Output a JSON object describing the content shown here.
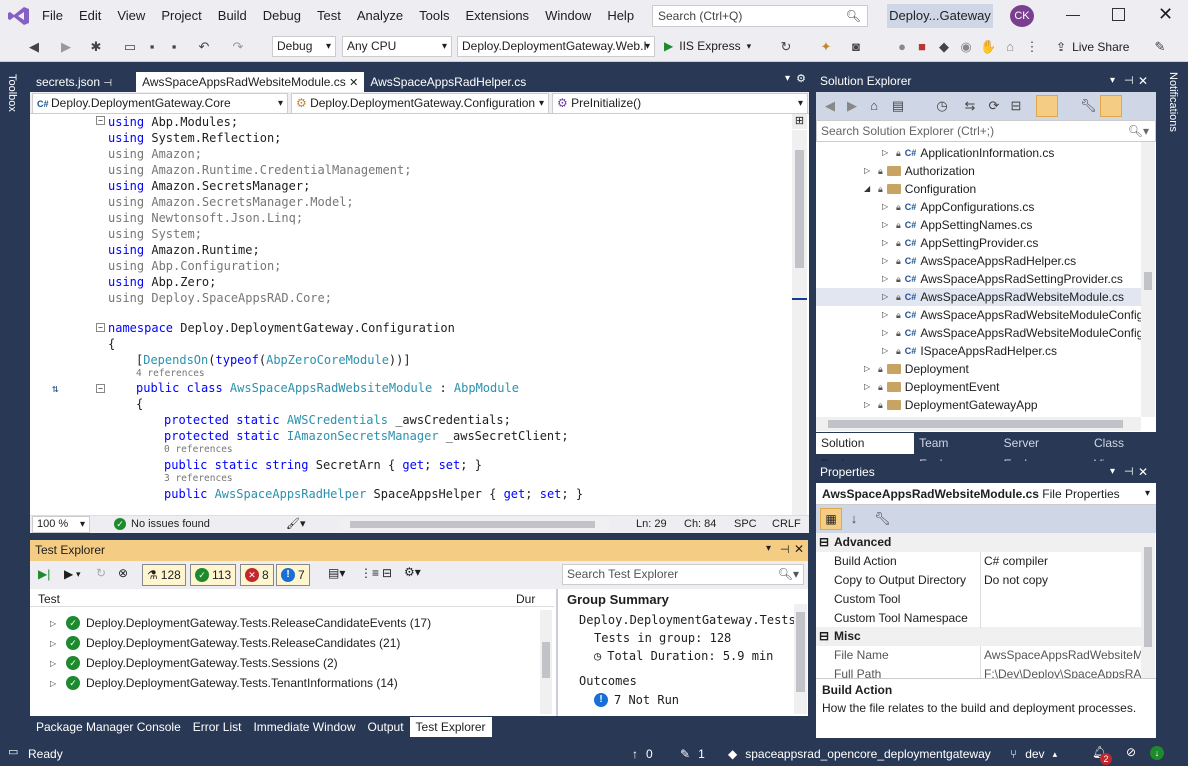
{
  "menu": [
    "File",
    "Edit",
    "View",
    "Project",
    "Build",
    "Debug",
    "Test",
    "Analyze",
    "Tools",
    "Extensions",
    "Window",
    "Help"
  ],
  "search_placeholder": "Search (Ctrl+Q)",
  "solution_short": "Deploy...Gateway",
  "user_initials": "CK",
  "toolbar": {
    "config": "Debug",
    "platform": "Any CPU",
    "startup": "Deploy.DeploymentGateway.Web.I",
    "run": "IIS Express",
    "live_share": "Live Share"
  },
  "side": {
    "toolbox": "Toolbox",
    "notifications": "Notifications"
  },
  "doc_tabs": [
    "secrets.json",
    "AwsSpaceAppsRadWebsiteModule.cs",
    "AwsSpaceAppsRadHelper.cs"
  ],
  "navbar": {
    "project": "Deploy.DeploymentGateway.Core",
    "type": "Deploy.DeploymentGateway.Configuration",
    "member": "PreInitialize()"
  },
  "code": {
    "u1": "using",
    "u1b": " Abp.Modules;",
    "u2b": " System.Reflection;",
    "u3b": " Amazon;",
    "u4b": " Amazon.Runtime.CredentialManagement;",
    "u5b": " Amazon.SecretsManager;",
    "u6b": " Amazon.SecretsManager.Model;",
    "u7b": " Newtonsoft.Json.Linq;",
    "u8b": " System;",
    "u9b": " Amazon.Runtime;",
    "u10b": " Abp.Configuration;",
    "u11b": " Abp.Zero;",
    "u12b": " Deploy.SpaceAppsRAD.Core;",
    "ns": "namespace",
    "nsname": " Deploy.DeploymentGateway.Configuration",
    "brace": "{",
    "attr1": "[",
    "attr2": "DependsOn",
    "attr3": "(",
    "attr4": "typeof",
    "attr5": "(",
    "attr6": "AbpZeroCoreModule",
    "attr7": "))]",
    "ref4": "4 references",
    "cls1": "public class ",
    "cls2": "AwsSpaceAppsRadWebsiteModule",
    "cls3": " : ",
    "cls4": "AbpModule",
    "f1a": "protected static ",
    "f1b": "AWSCredentials",
    "f1c": " _awsCredentials;",
    "f2a": "protected static ",
    "f2b": "IAmazonSecretsManager",
    "f2c": " _awsSecretClient;",
    "ref0": "0 references",
    "p1a": "public static string ",
    "p1b": "SecretArn { ",
    "p1c": "get",
    "p1d": "; ",
    "p1e": "set",
    "p1f": "; }",
    "ref3": "3 references",
    "p2a": "public ",
    "p2b": "AwsSpaceAppsRadHelper",
    "p2c": " SpaceAppsHelper { ",
    "p2d": "get",
    "p2e": "; ",
    "p2f": "set",
    "p2g": "; }"
  },
  "editor_status": {
    "zoom": "100 %",
    "issues": "No issues found",
    "ln": "Ln: 29",
    "ch": "Ch: 84",
    "spc": "SPC",
    "crlf": "CRLF"
  },
  "test_explorer": {
    "title": "Test Explorer",
    "counts": {
      "total": "128",
      "passed": "113",
      "failed": "8",
      "notrun": "7"
    },
    "search": "Search Test Explorer",
    "col_test": "Test",
    "col_dur": "Dur",
    "rows": [
      "Deploy.DeploymentGateway.Tests.ReleaseCandidateEvents (17)",
      "Deploy.DeploymentGateway.Tests.ReleaseCandidates (21)",
      "Deploy.DeploymentGateway.Tests.Sessions (2)",
      "Deploy.DeploymentGateway.Tests.TenantInformations (14)"
    ],
    "summary_title": "Group Summary",
    "summary_name": "Deploy.DeploymentGateway.Tests",
    "summary_count": "Tests in group: 128",
    "summary_dur": "Total Duration: 5.9 min",
    "outcomes": "Outcomes",
    "outcome1": "7 Not Run"
  },
  "bottom_tabs": [
    "Package Manager Console",
    "Error List",
    "Immediate Window",
    "Output",
    "Test Explorer"
  ],
  "solution_explorer": {
    "title": "Solution Explorer",
    "search": "Search Solution Explorer (Ctrl+;)",
    "items": [
      {
        "label": "ApplicationInformation.cs",
        "kind": "cs"
      },
      {
        "label": "Authorization",
        "kind": "folder"
      },
      {
        "label": "Configuration",
        "kind": "folder-open"
      },
      {
        "label": "AppConfigurations.cs",
        "kind": "cs"
      },
      {
        "label": "AppSettingNames.cs",
        "kind": "cs"
      },
      {
        "label": "AppSettingProvider.cs",
        "kind": "cs"
      },
      {
        "label": "AwsSpaceAppsRadHelper.cs",
        "kind": "cs"
      },
      {
        "label": "AwsSpaceAppsRadSettingProvider.cs",
        "kind": "cs"
      },
      {
        "label": "AwsSpaceAppsRadWebsiteModule.cs",
        "kind": "cs"
      },
      {
        "label": "AwsSpaceAppsRadWebsiteModuleConfig.",
        "kind": "cs"
      },
      {
        "label": "AwsSpaceAppsRadWebsiteModuleConfigu",
        "kind": "cs"
      },
      {
        "label": "ISpaceAppsRadHelper.cs",
        "kind": "cs"
      },
      {
        "label": "Deployment",
        "kind": "folder"
      },
      {
        "label": "DeploymentEvent",
        "kind": "folder"
      },
      {
        "label": "DeploymentGatewayApp",
        "kind": "folder"
      }
    ],
    "tabs": [
      "Solution Explorer",
      "Team Explorer",
      "Server Explorer",
      "Class View"
    ]
  },
  "properties": {
    "title": "Properties",
    "object": "AwsSpaceAppsRadWebsiteModule.cs",
    "object_type": "File Properties",
    "cat_advanced": "Advanced",
    "build_action_k": "Build Action",
    "build_action_v": "C# compiler",
    "copy_k": "Copy to Output Directory",
    "copy_v": "Do not copy",
    "tool_k": "Custom Tool",
    "tool_v": "",
    "ns_k": "Custom Tool Namespace",
    "ns_v": "",
    "cat_misc": "Misc",
    "fname_k": "File Name",
    "fname_v": "AwsSpaceAppsRadWebsiteMo",
    "fpath_k": "Full Path",
    "fpath_v": "F:\\Dev\\Deploy\\SpaceAppsRAI",
    "desc_title": "Build Action",
    "desc_text": "How the file relates to the build and deployment processes."
  },
  "status": {
    "ready": "Ready",
    "up": "0",
    "edits": "1",
    "repo": "spaceappsrad_opencore_deploymentgateway",
    "branch": "dev",
    "notif": "2"
  }
}
